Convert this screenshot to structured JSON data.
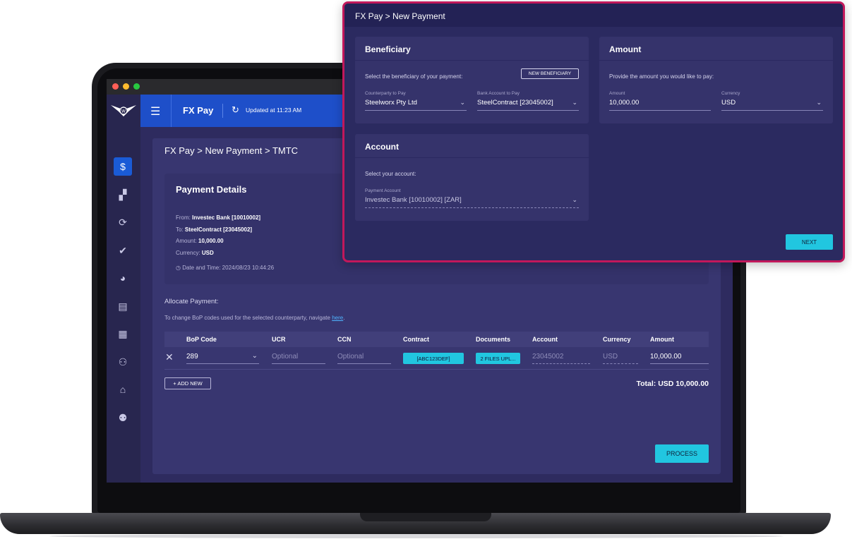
{
  "appbar": {
    "title": "FX Pay",
    "updated": "Updated at 11:23 AM"
  },
  "content": {
    "breadcrumb": "FX Pay > New Payment > TMTC",
    "details": {
      "title": "Payment Details",
      "from_label": "From: ",
      "from_value": "Investec Bank [10010002]",
      "to_label": "To: ",
      "to_value": "SteelContract [23045002]",
      "amount_label": "Amount: ",
      "amount_value": "10,000.00",
      "currency_label": "Currency: ",
      "currency_value": "USD",
      "datetime": "Date and Time: 2024/08/23 10:44:26"
    },
    "allocate_label": "Allocate Payment:",
    "bop_note": "To change BoP codes used for the selected counterparty, navigate ",
    "bop_link": "here",
    "bop_note_end": ".",
    "table": {
      "headers": {
        "bop": "BoP Code",
        "ucr": "UCR",
        "ccn": "CCN",
        "contract": "Contract",
        "documents": "Documents",
        "account": "Account",
        "currency": "Currency",
        "amount": "Amount"
      },
      "row": {
        "bop": "289",
        "ucr_placeholder": "Optional",
        "ccn_placeholder": "Optional",
        "contract": "[ABC123DEF]",
        "documents": "2 FILES UPL...",
        "account": "23045002",
        "currency": "USD",
        "amount": "10,000.00"
      }
    },
    "add_new": "+ ADD NEW",
    "total": "Total: USD 10,000.00",
    "process": "PROCESS"
  },
  "popup": {
    "title": "FX Pay > New Payment",
    "beneficiary": {
      "title": "Beneficiary",
      "text": "Select the beneficiary of your payment:",
      "new_button": "NEW BENEFICIARY",
      "counterparty_label": "Counterparty to Pay",
      "counterparty_value": "Steelworx Pty Ltd",
      "bank_label": "Bank Account to Pay",
      "bank_value": "SteelContract [23045002]"
    },
    "amount": {
      "title": "Amount",
      "text": "Provide the amount you would like to pay:",
      "amount_label": "Amount",
      "amount_value": "10,000.00",
      "currency_label": "Currency",
      "currency_value": "USD"
    },
    "account": {
      "title": "Account",
      "text": "Select your account:",
      "payment_label": "Payment Account",
      "payment_value": "Investec Bank [10010002] [ZAR]"
    },
    "next": "NEXT"
  },
  "colors": {
    "accent": "#21c6e0",
    "appbar": "#1e4fc9",
    "popup_border": "#c2185b"
  }
}
